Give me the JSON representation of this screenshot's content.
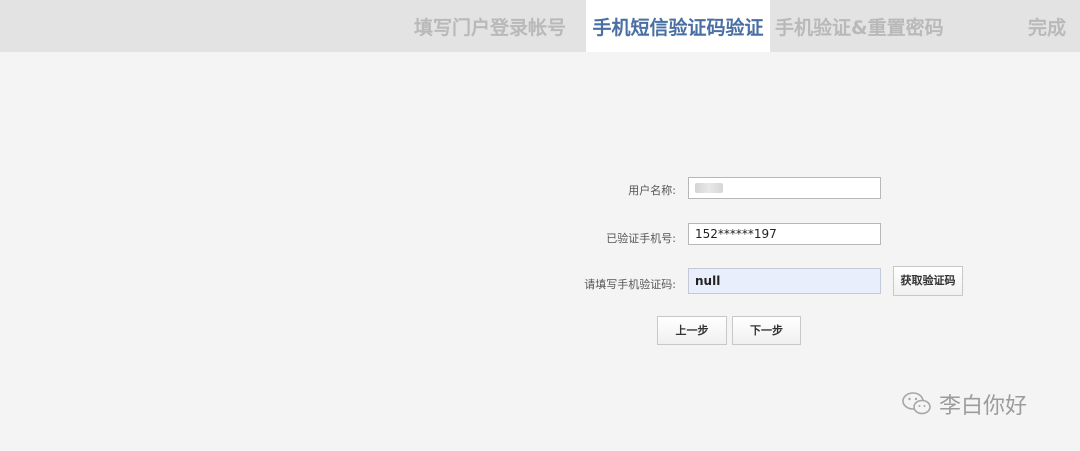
{
  "steps": [
    {
      "label": "填写门户登录帐号",
      "active": false
    },
    {
      "label": "手机短信验证码验证",
      "active": true
    },
    {
      "label": "手机验证&重置密码",
      "active": false
    },
    {
      "label": "完成",
      "active": false
    }
  ],
  "form": {
    "username": {
      "label": "用户名称:",
      "value": ""
    },
    "phone": {
      "label": "已验证手机号:",
      "value": "152******197"
    },
    "code": {
      "label": "请填写手机验证码:",
      "value": "null"
    },
    "get_code_label": "获取验证码"
  },
  "buttons": {
    "prev_label": "上一步",
    "next_label": "下一步"
  },
  "watermark": {
    "text": "李白你好",
    "icon": "wechat-icon"
  }
}
